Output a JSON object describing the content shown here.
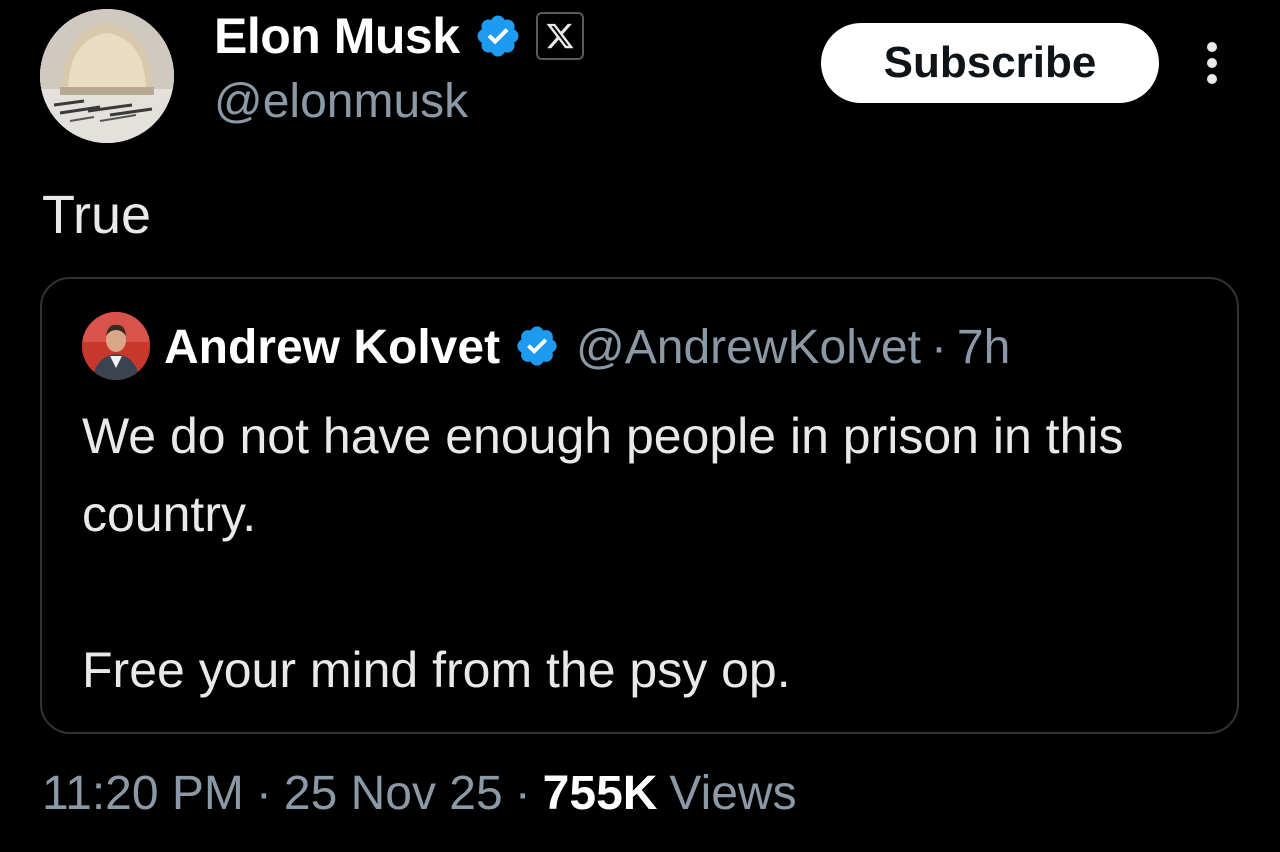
{
  "author": {
    "display_name": "Elon Musk",
    "handle": "@elonmusk",
    "verified_icon": "verified-badge-icon",
    "affiliation_icon": "x-logo-icon"
  },
  "actions": {
    "subscribe_label": "Subscribe",
    "more_icon": "more-options-icon"
  },
  "tweet": {
    "text": "True"
  },
  "quoted": {
    "display_name": "Andrew Kolvet",
    "handle": "@AndrewKolvet",
    "separator": "·",
    "time": "7h",
    "body_line1": "We do not have enough people in prison in this country.",
    "body_line2": "Free your mind from the psy op."
  },
  "footer": {
    "time": "11:20 PM",
    "sep1": "·",
    "date": "25 Nov 25",
    "sep2": "·",
    "views_count": "755K",
    "views_label": "Views"
  },
  "colors": {
    "background": "#000000",
    "primary_text": "#e7e9ea",
    "secondary_text": "#8b98a5",
    "verified_blue": "#1d9bf0",
    "border": "#2f3336"
  }
}
